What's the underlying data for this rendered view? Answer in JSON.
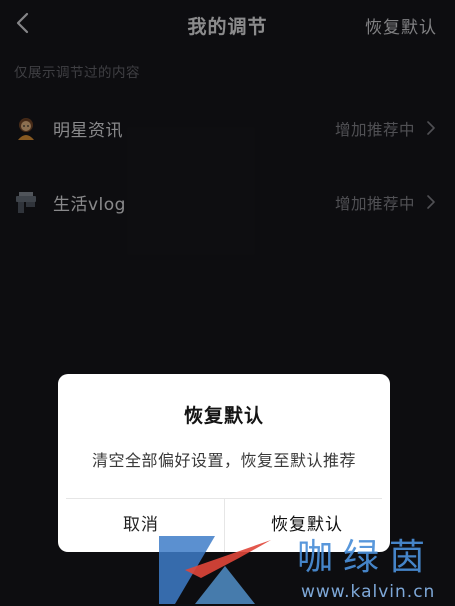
{
  "header": {
    "title": "我的调节",
    "reset_label": "恢复默认",
    "back_icon": "back-chevron-icon"
  },
  "hint": "仅展示调节过的内容",
  "rows": [
    {
      "label": "明星资讯",
      "status": "增加推荐中",
      "icon": "star-person-icon"
    },
    {
      "label": "生活vlog",
      "status": "增加推荐中",
      "icon": "life-vlog-icon"
    }
  ],
  "dialog": {
    "title": "恢复默认",
    "message": "清空全部偏好设置，恢复至默认推荐",
    "cancel_label": "取消",
    "confirm_label": "恢复默认"
  },
  "watermark": {
    "text": "咖绿茵",
    "url": "www.kalvin.cn"
  },
  "colors": {
    "background": "#18181d",
    "dialog_background": "#ffffff",
    "hint_text": "#6d6d74",
    "status_text": "#8a8a91",
    "watermark_blue": "#4a8fd8"
  }
}
